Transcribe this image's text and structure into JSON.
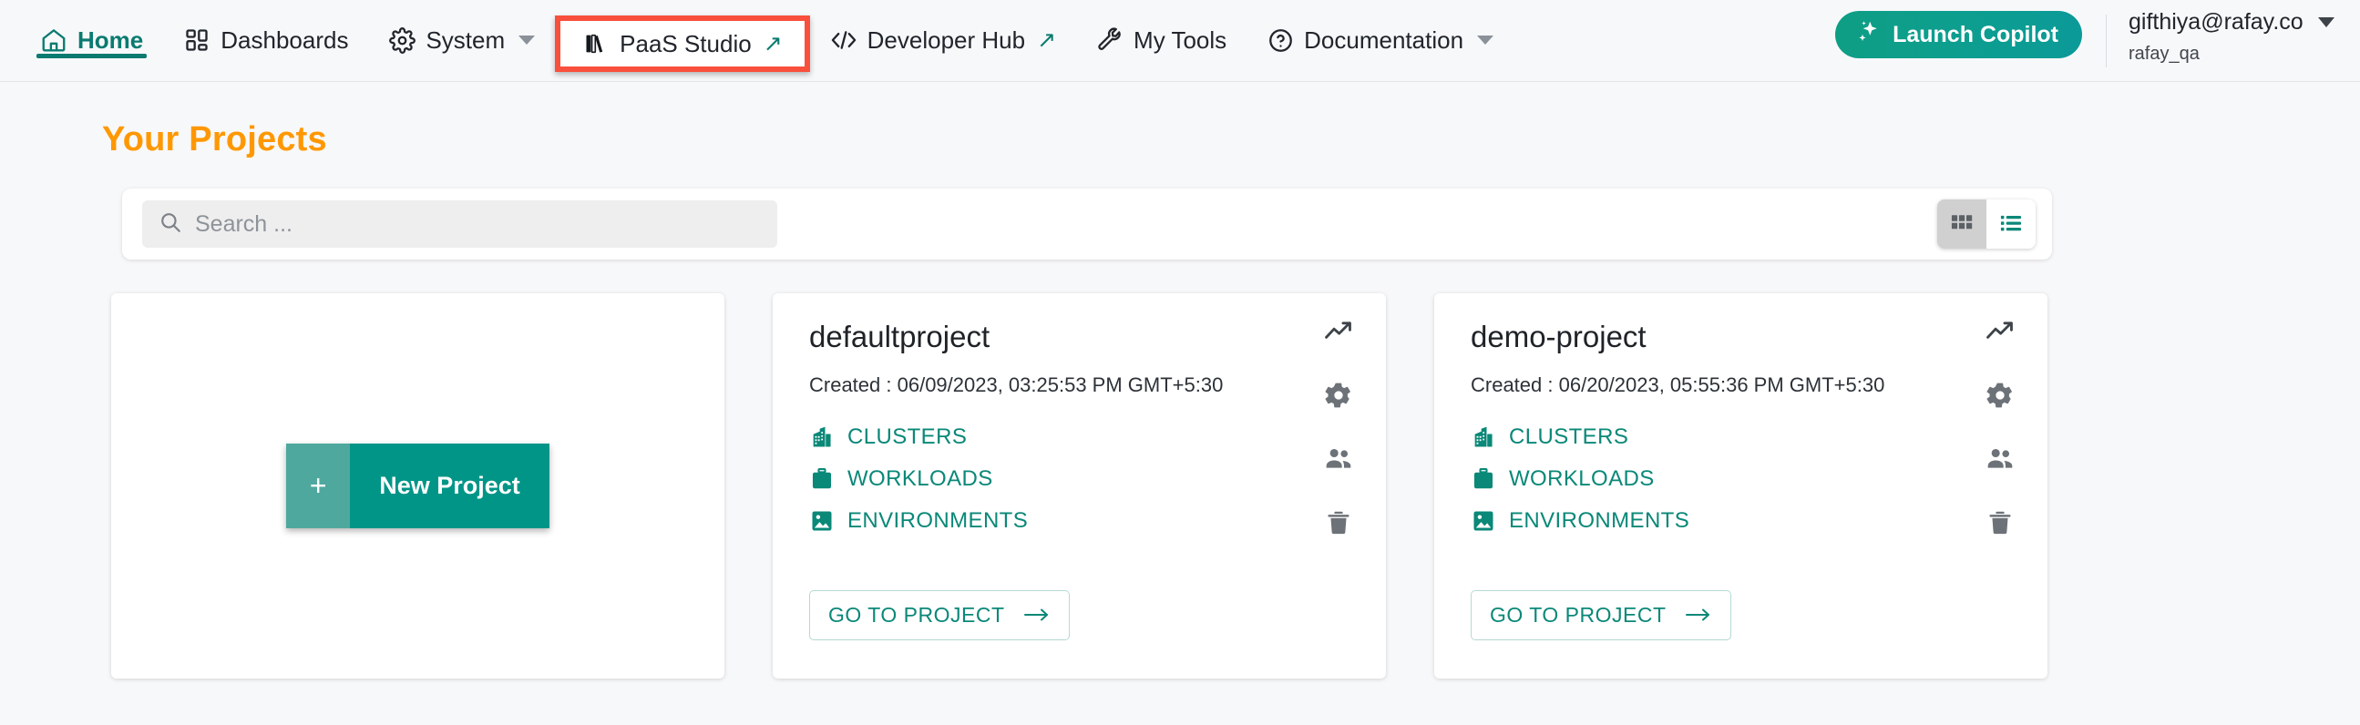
{
  "nav": {
    "items": [
      {
        "label": "Home",
        "icon": "home-icon",
        "active": true,
        "caret": false,
        "external": false
      },
      {
        "label": "Dashboards",
        "icon": "dashboards-icon",
        "active": false,
        "caret": false,
        "external": false
      },
      {
        "label": "System",
        "icon": "gear-icon",
        "active": false,
        "caret": true,
        "external": false
      },
      {
        "label": "PaaS Studio",
        "icon": "books-icon",
        "active": false,
        "caret": false,
        "external": true,
        "highlighted": true
      },
      {
        "label": "Developer Hub",
        "icon": "code-icon",
        "active": false,
        "caret": false,
        "external": true
      },
      {
        "label": "My Tools",
        "icon": "wrench-icon",
        "active": false,
        "caret": false,
        "external": false
      },
      {
        "label": "Documentation",
        "icon": "help-circle-icon",
        "active": false,
        "caret": true,
        "external": false
      }
    ],
    "copilot_label": "Launch Copilot",
    "user_email": "gifthiya@rafay.co",
    "user_org": "rafay_qa"
  },
  "page": {
    "title": "Your Projects"
  },
  "toolbar": {
    "search_placeholder": "Search ...",
    "search_value": "",
    "grid_view_selected": true,
    "list_view_selected": false
  },
  "new_project": {
    "plus": "+",
    "label": "New Project"
  },
  "projects": [
    {
      "name": "defaultproject",
      "created": "Created : 06/09/2023, 03:25:53 PM GMT+5:30",
      "links": [
        {
          "label": "CLUSTERS",
          "icon": "building-icon"
        },
        {
          "label": "WORKLOADS",
          "icon": "briefcase-icon"
        },
        {
          "label": "ENVIRONMENTS",
          "icon": "image-icon"
        }
      ],
      "goto_label": "GO TO PROJECT",
      "actions": [
        "trending-up-icon",
        "gear-icon",
        "users-icon",
        "trash-icon"
      ]
    },
    {
      "name": "demo-project",
      "created": "Created : 06/20/2023, 05:55:36 PM GMT+5:30",
      "links": [
        {
          "label": "CLUSTERS",
          "icon": "building-icon"
        },
        {
          "label": "WORKLOADS",
          "icon": "briefcase-icon"
        },
        {
          "label": "ENVIRONMENTS",
          "icon": "image-icon"
        }
      ],
      "goto_label": "GO TO PROJECT",
      "actions": [
        "trending-up-icon",
        "gear-icon",
        "users-icon",
        "trash-icon"
      ]
    }
  ],
  "colors": {
    "accent_teal": "#0a8878",
    "title_orange": "#ff9800",
    "highlight_red": "#f8503c",
    "copilot_green": "#0d9e8f",
    "page_bg": "#f7f8fa"
  }
}
